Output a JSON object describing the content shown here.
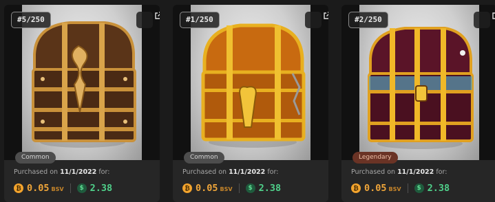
{
  "cards": [
    {
      "number": "#5/250",
      "rarity": "Common",
      "purchased_prefix": "Purchased on",
      "purchased_date": "11/1/2022",
      "purchased_suffix": "for:",
      "bsv_symbol": "₿",
      "bsv_amount": "0.05",
      "bsv_unit": "BSV",
      "usd_symbol": "$",
      "usd_amount": "2.38",
      "image_icon": "treasure-chest-bronze"
    },
    {
      "number": "#1/250",
      "rarity": "Common",
      "purchased_prefix": "Purchased on",
      "purchased_date": "11/1/2022",
      "purchased_suffix": "for:",
      "bsv_symbol": "₿",
      "bsv_amount": "0.05",
      "bsv_unit": "BSV",
      "usd_symbol": "$",
      "usd_amount": "2.38",
      "image_icon": "treasure-chest-gold"
    },
    {
      "number": "#2/250",
      "rarity": "Legendary",
      "purchased_prefix": "Purchased on",
      "purchased_date": "11/1/2022",
      "purchased_suffix": "for:",
      "bsv_symbol": "₿",
      "bsv_amount": "0.05",
      "bsv_unit": "BSV",
      "usd_symbol": "$",
      "usd_amount": "2.38",
      "image_icon": "treasure-chest-crimson"
    }
  ],
  "colors": {
    "bsv": "#f0a63a",
    "usd": "#4fd08a",
    "legendary_badge": "#6a3325",
    "common_badge": "#4d4d4d"
  }
}
